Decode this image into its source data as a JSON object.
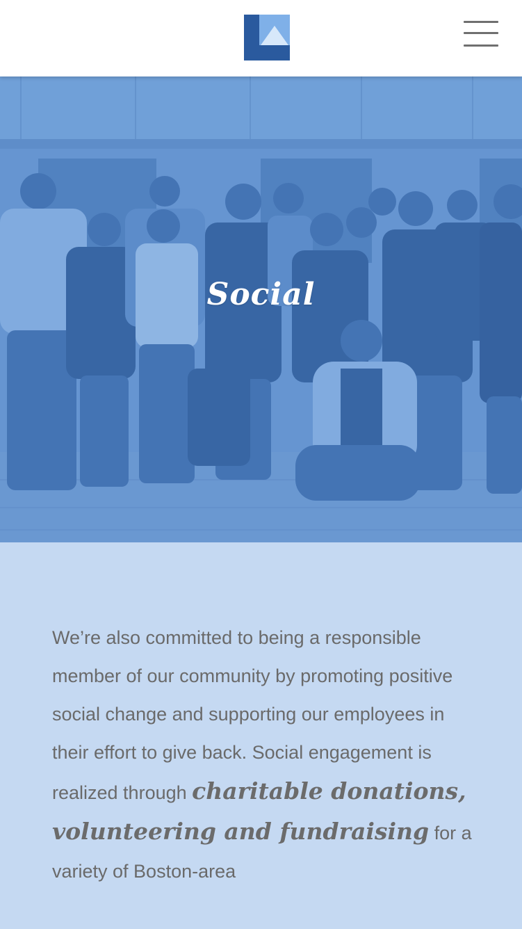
{
  "header": {
    "logo_icon": "lapham-logo-icon",
    "menu_icon": "hamburger-menu-icon",
    "colors": {
      "logo_dark": "#2a5a9e",
      "logo_light": "#7fb0e8",
      "logo_triangle": "#d7e8fa"
    }
  },
  "hero": {
    "title": "Social",
    "overlay_color": "#5b8ccd"
  },
  "content": {
    "text_before": "We’re also committed to being a responsible member of our community by promoting positive social change and supporting our employees in their effort to give back. Social engagement is realized through ",
    "emphasis": "charitable donations, volunteering and fundraising",
    "text_after": " for a variety of Boston-area",
    "background_color": "#c5d9f2"
  }
}
